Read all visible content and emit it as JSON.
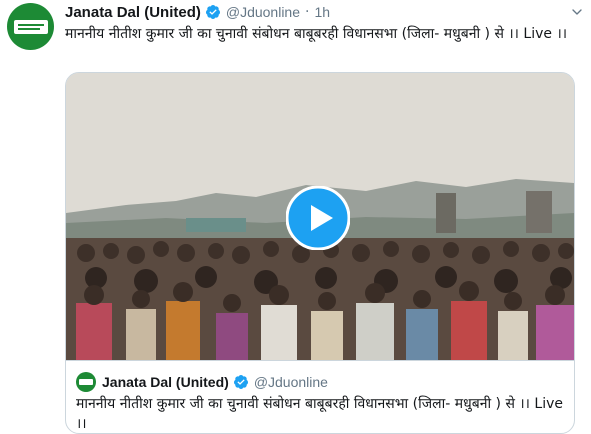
{
  "tweet": {
    "author_name": "Janata Dal (United)",
    "author_handle": "@Jduonline",
    "separator": "·",
    "timestamp": "1h",
    "text": "माननीय नीतीश कुमार जी का चुनावी संबोधन बाबूबरही विधानसभा (जिला- मधुबनी ) से ।। Live ।।",
    "verified_icon": "verified-badge-icon",
    "menu_icon": "chevron-down-icon"
  },
  "media": {
    "type": "video",
    "play_icon": "play-icon"
  },
  "quoted_tweet": {
    "author_name": "Janata Dal (United)",
    "author_handle": "@Jduonline",
    "text": "माननीय नीतीश कुमार जी का चुनावी संबोधन बाबूबरही विधानसभा (जिला- मधुबनी ) से ।। Live ।।"
  },
  "colors": {
    "accent": "#1da1f2",
    "brand_green": "#1d8a35",
    "secondary_text": "#657786"
  }
}
